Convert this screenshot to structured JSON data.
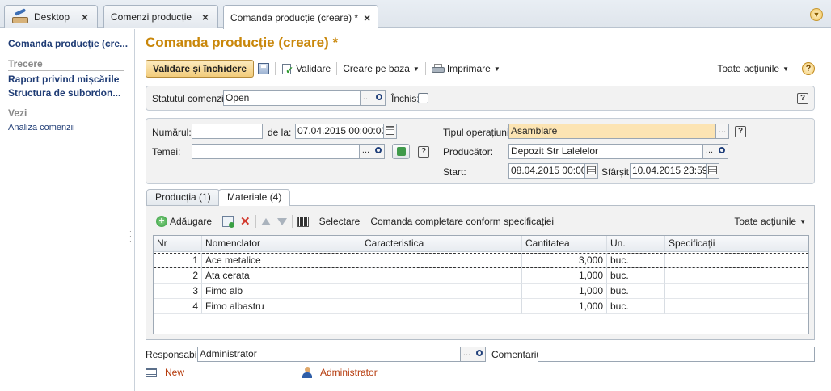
{
  "tabs": [
    {
      "label": "Desktop"
    },
    {
      "label": "Comenzi producție"
    },
    {
      "label": "Comanda producție (creare) *"
    }
  ],
  "sidebar": {
    "current": "Comanda producție (cre...",
    "section_trecere": "Trecere",
    "links_trecere": [
      "Raport privind mișcările",
      "Structura de subordon..."
    ],
    "section_vezi": "Vezi",
    "links_vezi": [
      "Analiza comenzii"
    ]
  },
  "form": {
    "title": "Comanda producție (creare) *",
    "toolbar": {
      "validate_close": "Validare și închidere",
      "validate": "Validare",
      "create_based": "Creare pe baza",
      "print": "Imprimare",
      "all_actions": "Toate acțiunile",
      "help": "?"
    },
    "status": {
      "label": "Statutul comenzii:",
      "value": "Open",
      "closed_label": "Închis:",
      "closed_checked": false
    },
    "header": {
      "number_label": "Numărul:",
      "number_value": "",
      "date_label": "de la:",
      "date_value": "07.04.2015 00:00:00",
      "basis_label": "Temei:",
      "basis_value": "",
      "op_type_label": "Tipul operațiunii:",
      "op_type_value": "Asamblare",
      "producer_label": "Producător:",
      "producer_value": "Depozit Str Lalelelor",
      "start_label": "Start:",
      "start_value": "08.04.2015 00:00:0",
      "end_label": "Sfârșit:",
      "end_value": "10.04.2015 23:59:5"
    },
    "subtabs": [
      "Producția (1)",
      "Materiale (4)"
    ],
    "materials_toolbar": {
      "add": "Adăugare",
      "select": "Selectare",
      "fill_by_spec": "Comanda completare conform specificației",
      "all_actions": "Toate acțiunile"
    },
    "table": {
      "columns": [
        "Nr",
        "Nomenclator",
        "Caracteristica",
        "Cantitatea",
        "Un.",
        "Specificații"
      ],
      "rows": [
        {
          "nr": "1",
          "item": "Ace metalice",
          "char": "",
          "qty": "3,000",
          "unit": "buc.",
          "spec": ""
        },
        {
          "nr": "2",
          "item": "Ata cerata",
          "char": "",
          "qty": "1,000",
          "unit": "buc.",
          "spec": ""
        },
        {
          "nr": "3",
          "item": "Fimo alb",
          "char": "",
          "qty": "1,000",
          "unit": "buc.",
          "spec": ""
        },
        {
          "nr": "4",
          "item": "Fimo albastru",
          "char": "",
          "qty": "1,000",
          "unit": "buc.",
          "spec": ""
        }
      ]
    },
    "footer": {
      "responsible_label": "Responsabil:",
      "responsible_value": "Administrator",
      "comment_label": "Comentariu:",
      "comment_value": ""
    },
    "statusbar": {
      "state": "New",
      "author": "Administrator"
    }
  },
  "colors": {
    "title": "#c9870a",
    "highlight_field": "#fce4b3",
    "link": "#1f3c75",
    "status_text": "#b5390a"
  }
}
